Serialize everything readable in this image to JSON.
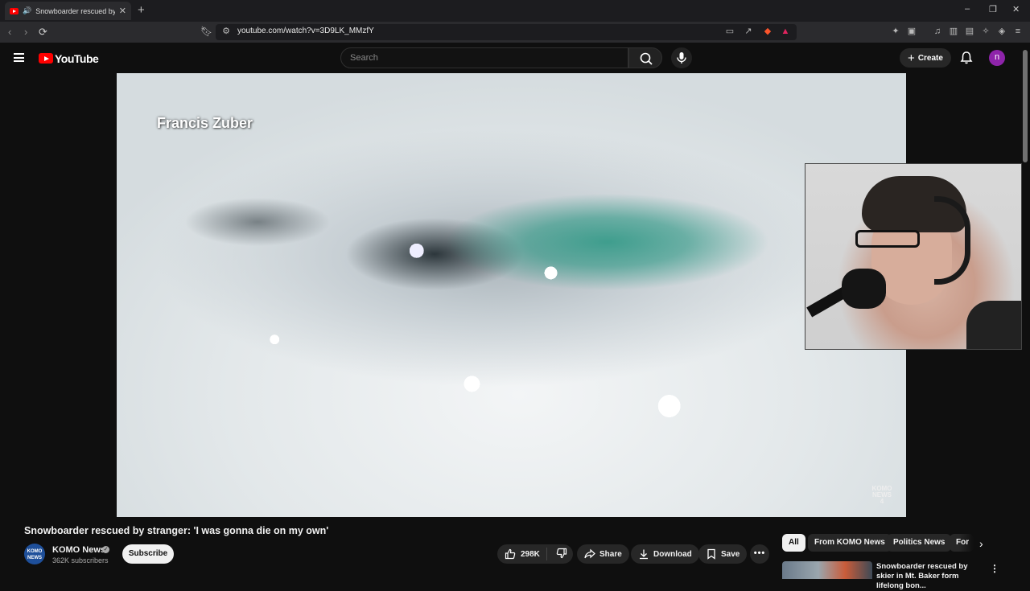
{
  "browser": {
    "tab_title": "Snowboarder rescued by stra",
    "url": "youtube.com/watch?v=3D9LK_MMzfY",
    "window_controls": [
      "–",
      "❐",
      "✕"
    ]
  },
  "header": {
    "logo_text": "YouTube",
    "search_placeholder": "Search",
    "create_label": "Create",
    "avatar_letter": "n"
  },
  "player": {
    "caption": "Francis Zuber",
    "watermark": "KOMO NEWS 4"
  },
  "video": {
    "title": "Snowboarder rescued by stranger: 'I was gonna die on my own'",
    "channel": "KOMO News",
    "channel_avatar_text": "KOMO NEWS",
    "subscribers": "362K subscribers",
    "subscribe_label": "Subscribe",
    "likes": "298K",
    "share_label": "Share",
    "download_label": "Download",
    "save_label": "Save"
  },
  "sidebar": {
    "chips": [
      "All",
      "From KOMO News",
      "Politics News",
      "For"
    ],
    "related": [
      {
        "title": "Snowboarder rescued by skier in Mt. Baker form lifelong bon..."
      }
    ]
  },
  "colors": {
    "brand_red": "#ff0000",
    "avatar_purple": "#8e24aa",
    "background": "#0f0f0f"
  }
}
